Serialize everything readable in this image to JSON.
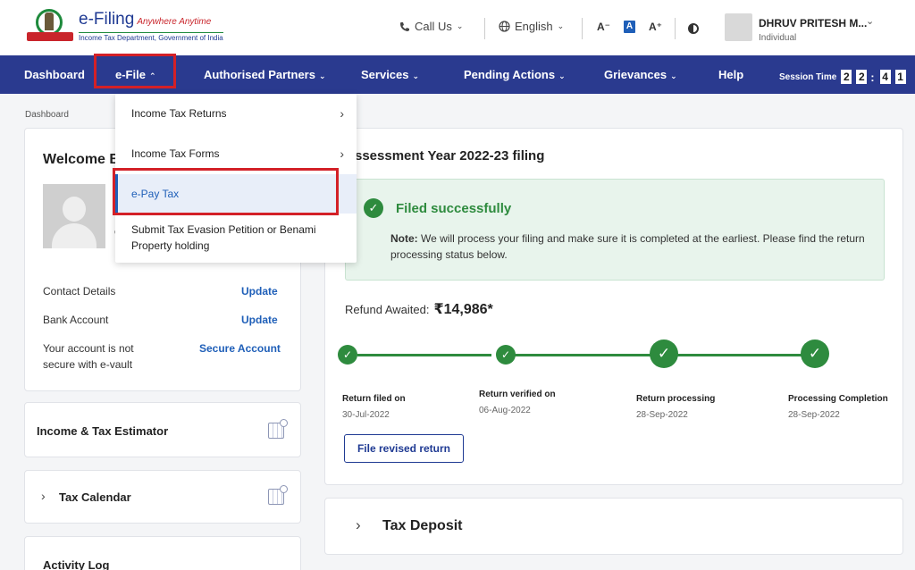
{
  "header": {
    "logo_title": "e-Filing",
    "logo_tagline": "Anywhere Anytime",
    "logo_subtitle": "Income Tax Department, Government of India",
    "call_us": "Call Us",
    "language": "English",
    "font_decrease": "A⁻",
    "font_normal": "A",
    "font_increase": "A⁺",
    "user_name": "DHRUV PRITESH M...",
    "user_role": "Individual"
  },
  "nav": {
    "items": [
      {
        "label": "Dashboard"
      },
      {
        "label": "e-File"
      },
      {
        "label": "Authorised Partners"
      },
      {
        "label": "Services"
      },
      {
        "label": "Pending Actions"
      },
      {
        "label": "Grievances"
      },
      {
        "label": "Help"
      }
    ],
    "session_label": "Session Time",
    "session_digits": [
      "2",
      "2",
      "4",
      "1"
    ]
  },
  "breadcrumb": "Dashboard",
  "dropdown": {
    "items": [
      {
        "label": "Income Tax Returns"
      },
      {
        "label": "Income Tax Forms"
      },
      {
        "label": "e-Pay Tax"
      },
      {
        "label_line1": "Submit Tax Evasion Petition or Benami",
        "label_line2": "Property holding"
      }
    ]
  },
  "profile": {
    "welcome": "Welcome B",
    "partial_1": "c",
    "partial_2": "I",
    "rows": [
      {
        "label": "Contact Details",
        "action": "Update"
      },
      {
        "label": "Bank Account",
        "action": "Update"
      },
      {
        "label_line1": "Your account is not",
        "label_line2": "secure with e-vault",
        "action": "Secure Account"
      }
    ]
  },
  "estimator": {
    "title": "Income & Tax Estimator"
  },
  "calendar": {
    "title": "Tax Calendar"
  },
  "activity": {
    "title": "Activity Log"
  },
  "filing": {
    "title": "ssessment Year 2022-23 filing",
    "status": "Filed successfully",
    "note_label": "Note:",
    "note_text": " We will process your filing and make sure it is completed at the earliest. Please find the return processing status below.",
    "refund_label": "Refund Awaited:",
    "refund_amount": "₹14,986*",
    "steps": [
      {
        "label": "Return filed on",
        "date": "30-Jul-2022"
      },
      {
        "label": "Return verified on",
        "date": "06-Aug-2022"
      },
      {
        "label": "Return processing",
        "date": "28-Sep-2022"
      },
      {
        "label": "Processing Completion",
        "date": "28-Sep-2022"
      }
    ],
    "revise_button": "File revised return"
  },
  "deposit": {
    "title": "Tax Deposit"
  },
  "colors": {
    "nav_bg": "#2a3a8f",
    "accent_blue": "#1f5fb8",
    "success_green": "#2e8b3e",
    "highlight_red": "#d32027"
  }
}
